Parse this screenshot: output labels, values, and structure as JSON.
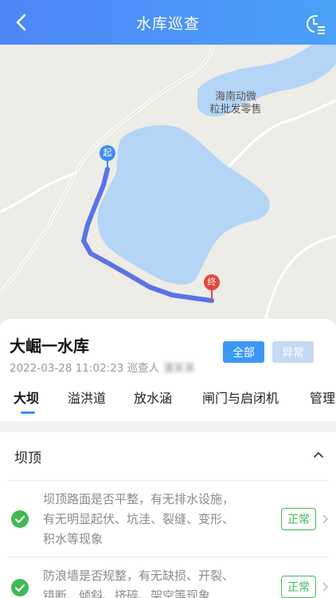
{
  "header": {
    "title": "水库巡查",
    "back_icon": "chevron-left-icon",
    "history_icon": "clock-list-icon"
  },
  "map": {
    "poi_label_line1": "海南动微",
    "poi_label_line2": "粒批发零售",
    "start_marker": "起",
    "end_marker": "终",
    "colors": {
      "water": "#b4d5f6",
      "route": "#5a73e6",
      "start": "#3d8ef0",
      "end": "#e8453c"
    }
  },
  "card": {
    "reservoir_name": "大崛一水库",
    "datetime": "2022-03-28 11:02:23",
    "inspector_label": "巡查人",
    "inspector_name": "潘某某",
    "filter_all": "全部",
    "filter_abnormal": "异常",
    "tabs": [
      "大坝",
      "溢洪道",
      "放水涵",
      "闸门与启闭机",
      "管理"
    ],
    "active_tab": 0
  },
  "section": {
    "title": "坝顶",
    "items": [
      {
        "line1": "坝顶路面是否平整，有无排水设施，",
        "line2": "有无明显起伏、坑洼、裂缝、变形、",
        "line3": "积水等现象",
        "status": "正常"
      },
      {
        "line1": "防浪墙是否规整，有无缺损、开裂、",
        "line2": "错断、倾斜、挤碎、架空等现象",
        "status": "正常"
      }
    ],
    "colors": {
      "ok": "#3fba55"
    }
  }
}
